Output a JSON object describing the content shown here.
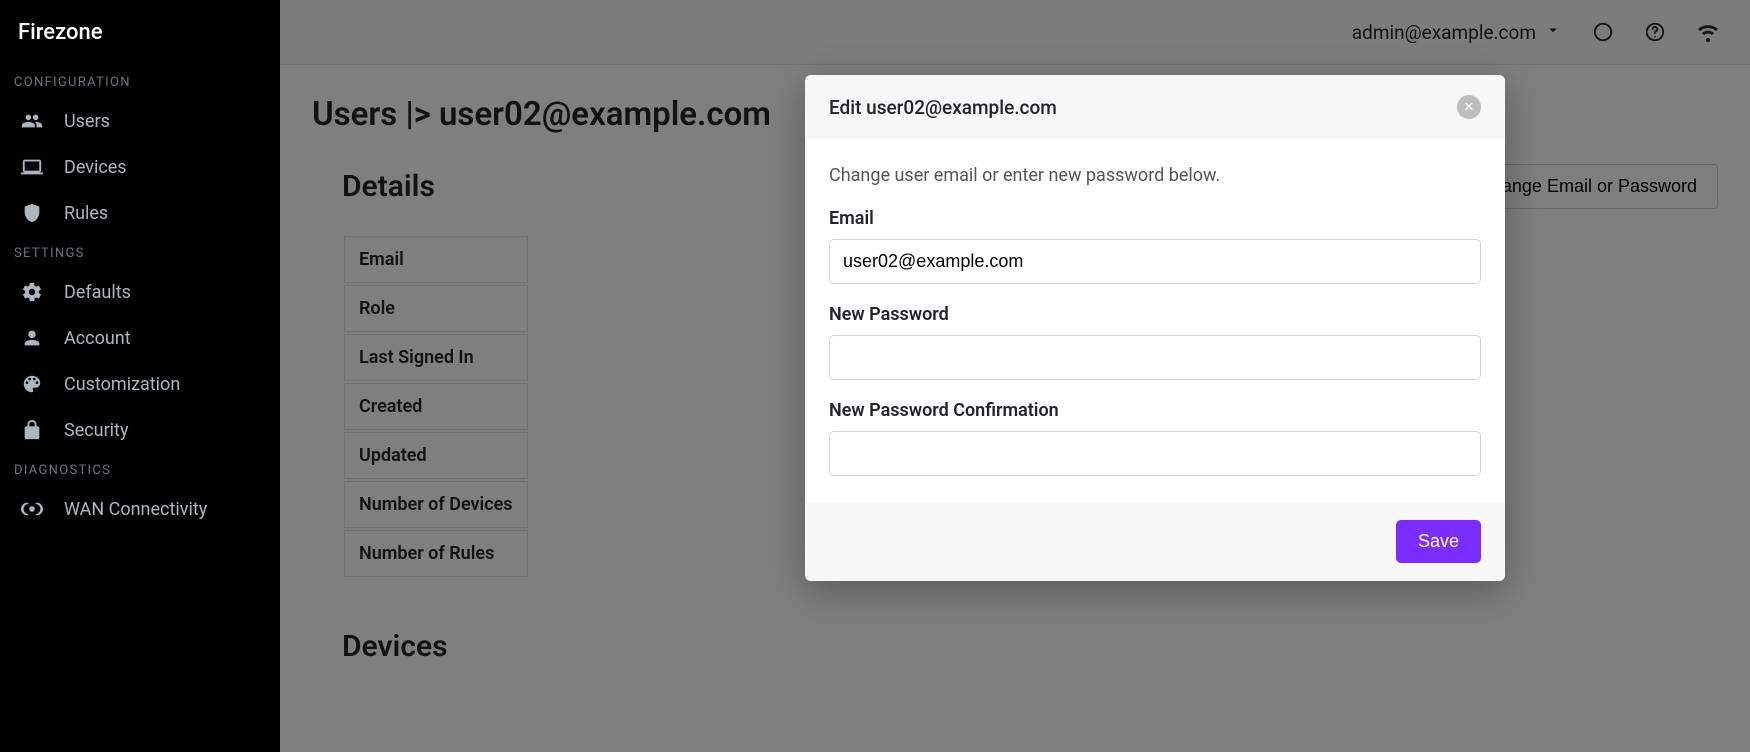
{
  "brand": "Firezone",
  "sidebar": {
    "sections": [
      {
        "label": "CONFIGURATION",
        "items": [
          {
            "icon": "users-icon",
            "label": "Users"
          },
          {
            "icon": "laptop-icon",
            "label": "Devices"
          },
          {
            "icon": "rules-icon",
            "label": "Rules"
          }
        ]
      },
      {
        "label": "SETTINGS",
        "items": [
          {
            "icon": "gear-icon",
            "label": "Defaults"
          },
          {
            "icon": "person-icon",
            "label": "Account"
          },
          {
            "icon": "palette-icon",
            "label": "Customization"
          },
          {
            "icon": "lock-icon",
            "label": "Security"
          }
        ]
      },
      {
        "label": "DIAGNOSTICS",
        "items": [
          {
            "icon": "antenna-icon",
            "label": "WAN Connectivity"
          }
        ]
      }
    ]
  },
  "header": {
    "user_email": "admin@example.com"
  },
  "page": {
    "breadcrumb": "Users |> user02@example.com",
    "details_heading": "Details",
    "change_button": "Change Email or Password",
    "detail_rows": [
      "Email",
      "Role",
      "Last Signed In",
      "Created",
      "Updated",
      "Number of Devices",
      "Number of Rules"
    ],
    "devices_heading": "Devices"
  },
  "modal": {
    "title": "Edit user02@example.com",
    "description": "Change user email or enter new password below.",
    "email_label": "Email",
    "email_value": "user02@example.com",
    "new_password_label": "New Password",
    "new_password_value": "",
    "confirm_label": "New Password Confirmation",
    "confirm_value": "",
    "save_label": "Save"
  },
  "colors": {
    "accent": "#7b2cff"
  }
}
